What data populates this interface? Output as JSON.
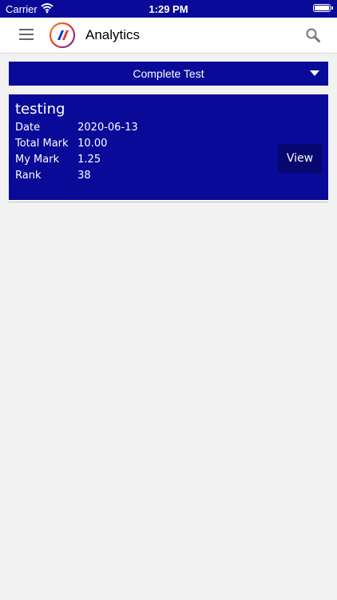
{
  "status": {
    "carrier": "Carrier",
    "time": "1:29 PM"
  },
  "nav": {
    "title": "Analytics"
  },
  "filter": {
    "selected": "Complete Test"
  },
  "card": {
    "title": "testing",
    "rows": [
      {
        "label": "Date",
        "value": "2020-06-13"
      },
      {
        "label": "Total Mark",
        "value": "10.00"
      },
      {
        "label": "My Mark",
        "value": "1.25"
      },
      {
        "label": "Rank",
        "value": "38"
      }
    ],
    "view_label": "View"
  },
  "colors": {
    "primary": "#0a0a98",
    "button_dark": "#070770",
    "background": "#f2f2f2"
  }
}
